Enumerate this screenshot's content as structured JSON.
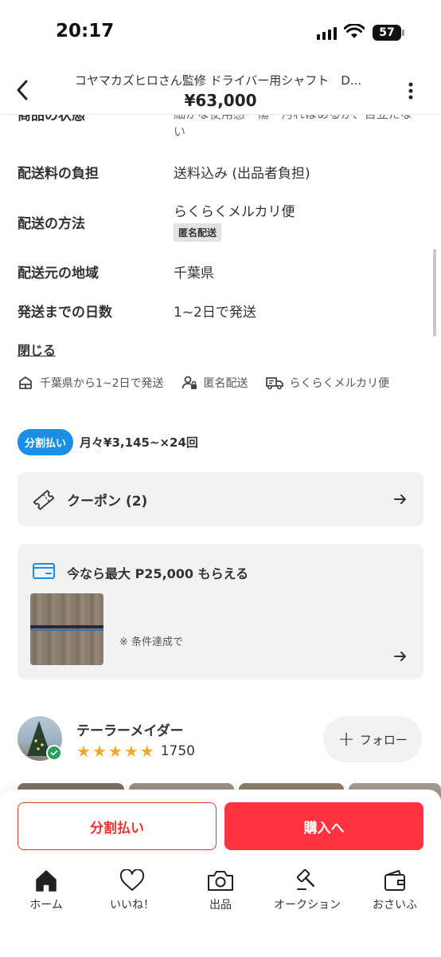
{
  "status_bar": {
    "time": "20:17",
    "battery": "57"
  },
  "header": {
    "title": "コヤマカズヒロさん監修 ドライバー用シャフト　D...",
    "price": "¥63,000"
  },
  "details": {
    "cut_row": {
      "label": "商品の状態",
      "value": "細かな使用感・傷・汚れはあるが、目立たない"
    },
    "rows": [
      {
        "label": "配送料の負担",
        "value": "送料込み (出品者負担)"
      },
      {
        "label": "配送の方法",
        "value": "らくらくメルカリ便",
        "tag": "匿名配送"
      },
      {
        "label": "配送元の地域",
        "value": "千葉県"
      },
      {
        "label": "発送までの日数",
        "value": "1~2日で発送"
      }
    ],
    "close_label": "閉じる"
  },
  "info_chips": [
    {
      "icon": "shipping-box-icon",
      "label": "千葉県から1~2日で発送"
    },
    {
      "icon": "anonymous-user-icon",
      "label": "匿名配送"
    },
    {
      "icon": "delivery-truck-icon",
      "label": "らくらくメルカリ便"
    }
  ],
  "installment": {
    "badge": "分割払い",
    "text": "月々¥3,145~×24回"
  },
  "coupon": {
    "label": "クーポン (2)"
  },
  "points": {
    "label": "今なら最大 P25,000 もらえる",
    "note": "※ 条件達成で"
  },
  "seller": {
    "name": "テーラーメイダー",
    "rating": 5,
    "review_count": "1750",
    "follow_label": "フォロー"
  },
  "actions": {
    "split_label": "分割払い",
    "buy_label": "購入へ"
  },
  "tabs": [
    {
      "label": "ホーム",
      "icon": "home-icon"
    },
    {
      "label": "いいね！",
      "icon": "heart-icon"
    },
    {
      "label": "出品",
      "icon": "camera-icon"
    },
    {
      "label": "オークション",
      "icon": "gavel-icon"
    },
    {
      "label": "おさいふ",
      "icon": "wallet-icon"
    }
  ],
  "colors": {
    "accent_red": "#ff333f",
    "installment_blue": "#1a8fe8",
    "star": "#f5a623"
  }
}
